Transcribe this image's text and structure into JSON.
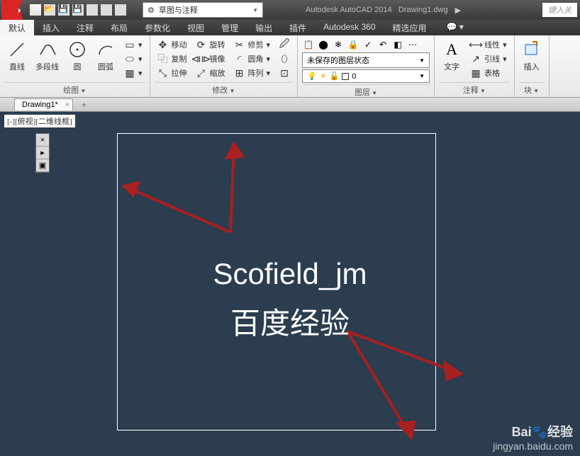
{
  "titlebar": {
    "dropdown_label": "草图与注释",
    "app": "Autodesk AutoCAD 2014",
    "file": "Drawing1.dwg",
    "search_placeholder": "键入关"
  },
  "menu": {
    "tabs": [
      "默认",
      "插入",
      "注释",
      "布局",
      "参数化",
      "视图",
      "管理",
      "输出",
      "插件",
      "Autodesk 360",
      "精选应用"
    ]
  },
  "ribbon": {
    "draw": {
      "label": "绘图",
      "line": "直线",
      "polyline": "多段线",
      "circle": "圆",
      "arc": "圆弧"
    },
    "modify": {
      "label": "修改",
      "move": "移动",
      "copy": "复制",
      "stretch": "拉伸",
      "rotate": "旋转",
      "mirror": "镜像",
      "scale": "缩放",
      "trim": "修剪",
      "fillet": "圆角",
      "array": "阵列"
    },
    "layer": {
      "label": "图层",
      "unsaved": "未保存的图层状态"
    },
    "annotate": {
      "label": "注释",
      "text": "文字",
      "linear": "线性",
      "leader": "引线",
      "table": "表格"
    },
    "block": {
      "label": "块",
      "insert": "插入"
    }
  },
  "filetab": {
    "name": "Drawing1*"
  },
  "canvas": {
    "view_label": "[-][俯视][二维线框]",
    "watermark1": "Scofield_jm",
    "watermark2": "百度经验"
  },
  "footer": {
    "logo_prefix": "Bai",
    "logo_suffix": "经验",
    "url": "jingyan.baidu.com"
  }
}
